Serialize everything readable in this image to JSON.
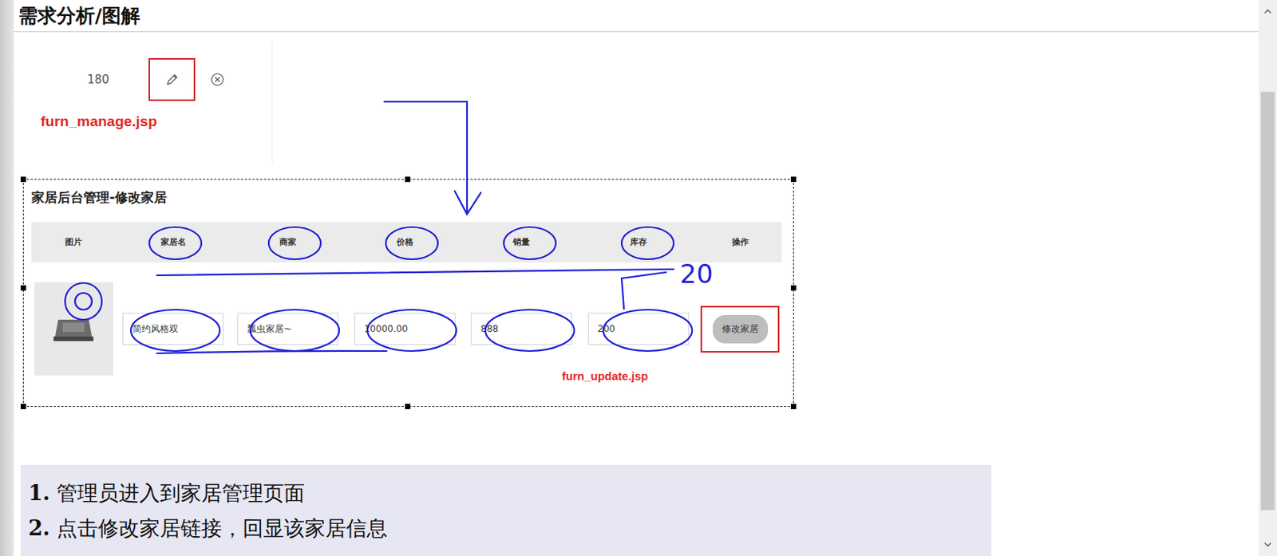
{
  "heading": "需求分析/图解",
  "manage_page": {
    "value": "180",
    "label": "furn_manage.jsp"
  },
  "update_page": {
    "title": "家居后台管理-修改家居",
    "columns": [
      "图片",
      "家居名",
      "商家",
      "价格",
      "销量",
      "库存",
      "操作"
    ],
    "fields": [
      "简约风格双",
      "瓢虫家居~",
      "10000.00",
      "888",
      "200"
    ],
    "button": "修改家居",
    "label": "furn_update.jsp"
  },
  "annotation": "20",
  "steps": [
    {
      "number": "1.",
      "text": "管理员进入到家居管理页面"
    },
    {
      "number": "2.",
      "text": "点击修改家居链接，回显该家居信息"
    }
  ]
}
